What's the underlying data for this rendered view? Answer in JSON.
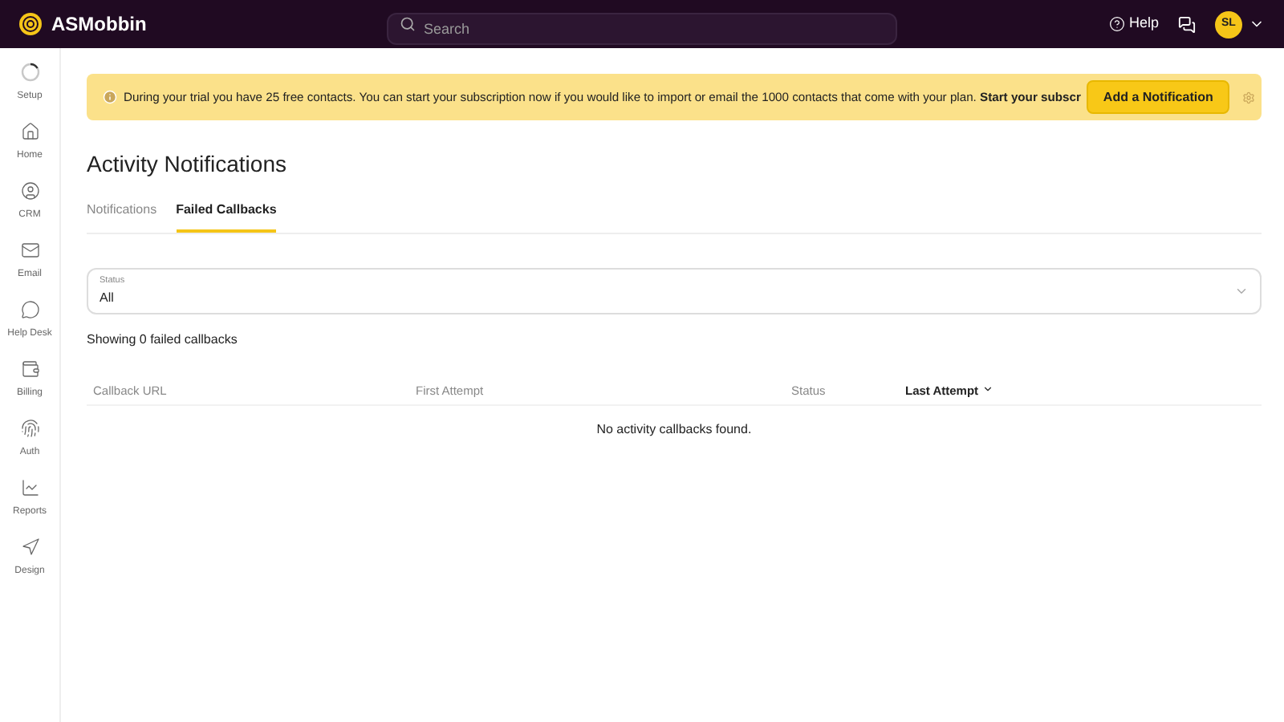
{
  "header": {
    "brand": "ASMobbin",
    "search": {
      "placeholder": "Search"
    },
    "help": "Help",
    "avatar": "SL"
  },
  "sidebar": {
    "items": [
      {
        "label": "Setup",
        "kind": "setup"
      },
      {
        "label": "Home",
        "kind": "home"
      },
      {
        "label": "CRM",
        "kind": "crm"
      },
      {
        "label": "Email",
        "kind": "email"
      },
      {
        "label": "Help Desk",
        "kind": "helpdesk"
      },
      {
        "label": "Billing",
        "kind": "billing"
      },
      {
        "label": "Auth",
        "kind": "auth"
      },
      {
        "label": "Reports",
        "kind": "reports"
      },
      {
        "label": "Design",
        "kind": "design"
      }
    ]
  },
  "banner": {
    "text": "During your trial you have 25 free contacts. You can start your subscription now if you would like to import or email the 1000 contacts that come with your plan. **Start your subscr**",
    "button": "Add a Notification"
  },
  "page": {
    "title": "Activity Notifications",
    "tabs": [
      {
        "label": "Notifications",
        "selected": false
      },
      {
        "label": "Failed Callbacks",
        "selected": true
      }
    ],
    "status_filter": {
      "label": "Status",
      "value": "All"
    },
    "count": "Showing 0 failed callbacks",
    "table": {
      "columns": [
        {
          "label": "Callback URL",
          "sorted": false
        },
        {
          "label": "First Attempt",
          "sorted": false
        },
        {
          "label": "Status",
          "sorted": false
        },
        {
          "label": "Last Attempt",
          "sorted": true
        }
      ],
      "empty": "No activity callbacks found."
    }
  }
}
